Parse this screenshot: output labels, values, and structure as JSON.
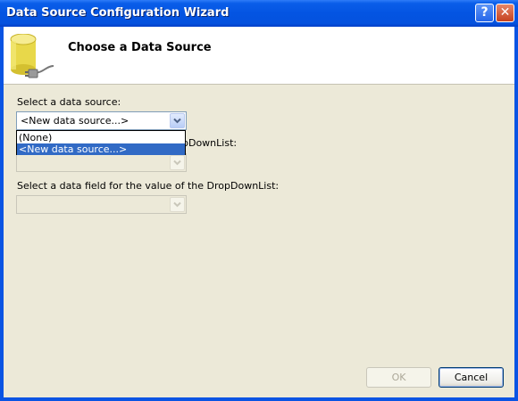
{
  "window": {
    "title": "Data Source Configuration Wizard",
    "help_label": "?",
    "close_label": "✕"
  },
  "header": {
    "title": "Choose a Data Source",
    "icon": "database-plug-icon"
  },
  "data_source": {
    "label": "Select a data source:",
    "selected_value": "<New data source...>",
    "options": [
      "(None)",
      "<New data source...>"
    ],
    "highlighted_option": "<New data source...>"
  },
  "display_field": {
    "label_visible_fragment": "pDownList:"
  },
  "value_field": {
    "label": "Select a data field for the value of the DropDownList:"
  },
  "buttons": {
    "ok": "OK",
    "cancel": "Cancel"
  },
  "colors": {
    "titlebar": "#0454e2",
    "selection": "#316ac5",
    "dialog_bg": "#ece9d8"
  }
}
